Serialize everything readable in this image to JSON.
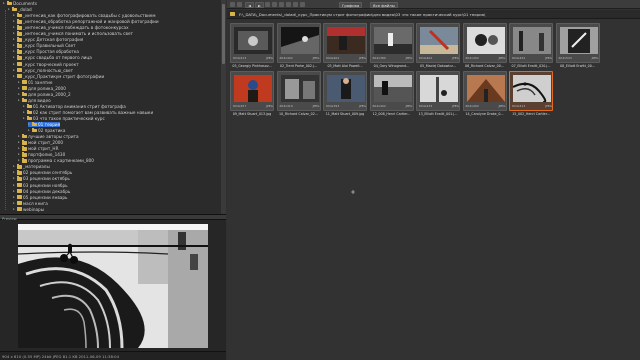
{
  "tree": {
    "items": [
      {
        "label": "Documents",
        "depth": 0
      },
      {
        "label": "_dolad",
        "depth": 1
      },
      {
        "label": "_интенсив_как фотографировать свадьбы с удовольствием",
        "depth": 2
      },
      {
        "label": "_интенсив_обработка репортажной и жанровой фотографии",
        "depth": 2
      },
      {
        "label": "_интенсив_учимся побеждать в фотоконкурсах",
        "depth": 2
      },
      {
        "label": "_интенсив_учимся понимать и использовать свет",
        "depth": 2
      },
      {
        "label": "_курс Детская фотография",
        "depth": 2
      },
      {
        "label": "_курс Правильный Свет",
        "depth": 2
      },
      {
        "label": "_курс Простая обработка",
        "depth": 2
      },
      {
        "label": "_курс свадьба от первого лица",
        "depth": 2
      },
      {
        "label": "_курс творческий проект",
        "depth": 2
      },
      {
        "label": "_курс_полностью_свет",
        "depth": 2
      },
      {
        "label": "_курс_Практикум стрит фотографии",
        "depth": 2
      },
      {
        "label": "01 занятие",
        "depth": 3
      },
      {
        "label": "для ролика_2000",
        "depth": 3
      },
      {
        "label": "для ролика_2000_2",
        "depth": 3
      },
      {
        "label": "для видео",
        "depth": 3
      },
      {
        "label": "01 Активатор внимания стрит фотографа",
        "depth": 4
      },
      {
        "label": "02 как стрит помогает вам развивать важные навыки",
        "depth": 4
      },
      {
        "label": "03 что такое практический курс",
        "depth": 4
      },
      {
        "label": "01 теория",
        "depth": 5,
        "selected": true
      },
      {
        "label": "02 практика",
        "depth": 5
      },
      {
        "label": "лучшие авторы стрита",
        "depth": 3
      },
      {
        "label": "мой стрит_2000",
        "depth": 3
      },
      {
        "label": "мой стрит_HR",
        "depth": 3
      },
      {
        "label": "портфолио_1430",
        "depth": 3
      },
      {
        "label": "программа с картинками_800",
        "depth": 3
      },
      {
        "label": "_материалы",
        "depth": 2
      },
      {
        "label": "02 рецензии сентябрь",
        "depth": 2
      },
      {
        "label": "03 рецензии октябрь",
        "depth": 2
      },
      {
        "label": "03 рецензии ноябрь",
        "depth": 2
      },
      {
        "label": "04 рецензии декабрь",
        "depth": 2
      },
      {
        "label": "05 рецензии январь",
        "depth": 2
      },
      {
        "label": "масл книга",
        "depth": 2
      },
      {
        "label": "webinapы",
        "depth": 2
      }
    ]
  },
  "preview": {
    "header_label": "Preview"
  },
  "status": {
    "text": "904 x 610 (0.55 MP)  24bit  JPEG  81.1 KB  2011-06-09 11:38:04"
  },
  "toolbar": {
    "back_label": "◄",
    "forward_label": "►",
    "graphics_label": "Графика",
    "all_files_label": "Все файлы"
  },
  "path": {
    "text": "F:\\_DATA\\_Documents\\_dolad\\_курс_Практикум стрит фотографии\\для видео\\03 что такое практический курс\\01 теория\\"
  },
  "thumbnails": [
    {
      "name": "05_Georgiy Pinkhasov...",
      "dims": "604x413",
      "fmt": "JPEG",
      "scene": "a"
    },
    {
      "name": "02_Trent Parke_002.j...",
      "dims": "604x402",
      "fmt": "JPEG",
      "scene": "b"
    },
    {
      "name": "03_Matt Aloi Powell...",
      "dims": "604x402",
      "fmt": "JPEG",
      "scene": "c"
    },
    {
      "name": "04_Gary Winogrand...",
      "dims": "604x380",
      "fmt": "JPEG",
      "scene": "d"
    },
    {
      "name": "05_Maciej Dakowicz...",
      "dims": "604x402",
      "fmt": "JPEG",
      "scene": "e"
    },
    {
      "name": "06_Richard Calvar_00...",
      "dims": "604x402",
      "fmt": "JPEG",
      "scene": "f"
    },
    {
      "name": "07_Elliott Erwitt_020.j...",
      "dims": "604x422",
      "fmt": "JPEG",
      "scene": "g"
    },
    {
      "name": "08_Elliott Erwitt_00...",
      "dims": "604x543",
      "fmt": "JPEG",
      "scene": "h"
    },
    {
      "name": "09_Matt Stuart_013.jpg",
      "dims": "604x457",
      "fmt": "JPEG",
      "scene": "i"
    },
    {
      "name": "10_Richard Calvar_02...",
      "dims": "604x419",
      "fmt": "JPEG",
      "scene": "j"
    },
    {
      "name": "11_Matt Stuart_009.jpg",
      "dims": "604x393",
      "fmt": "JPEG",
      "scene": "k"
    },
    {
      "name": "12_008_Henri Cartier...",
      "dims": "604x402",
      "fmt": "JPEG",
      "scene": "l"
    },
    {
      "name": "13_Elliott Erwitt_001.j...",
      "dims": "604x434",
      "fmt": "JPEG",
      "scene": "m"
    },
    {
      "name": "14_Carolyne Drake_0...",
      "dims": "604x402",
      "fmt": "JPEG",
      "scene": "n"
    },
    {
      "name": "15_002_Henri Cartier...",
      "dims": "604x413",
      "fmt": "JPEG",
      "scene": "o",
      "selected": true
    }
  ]
}
